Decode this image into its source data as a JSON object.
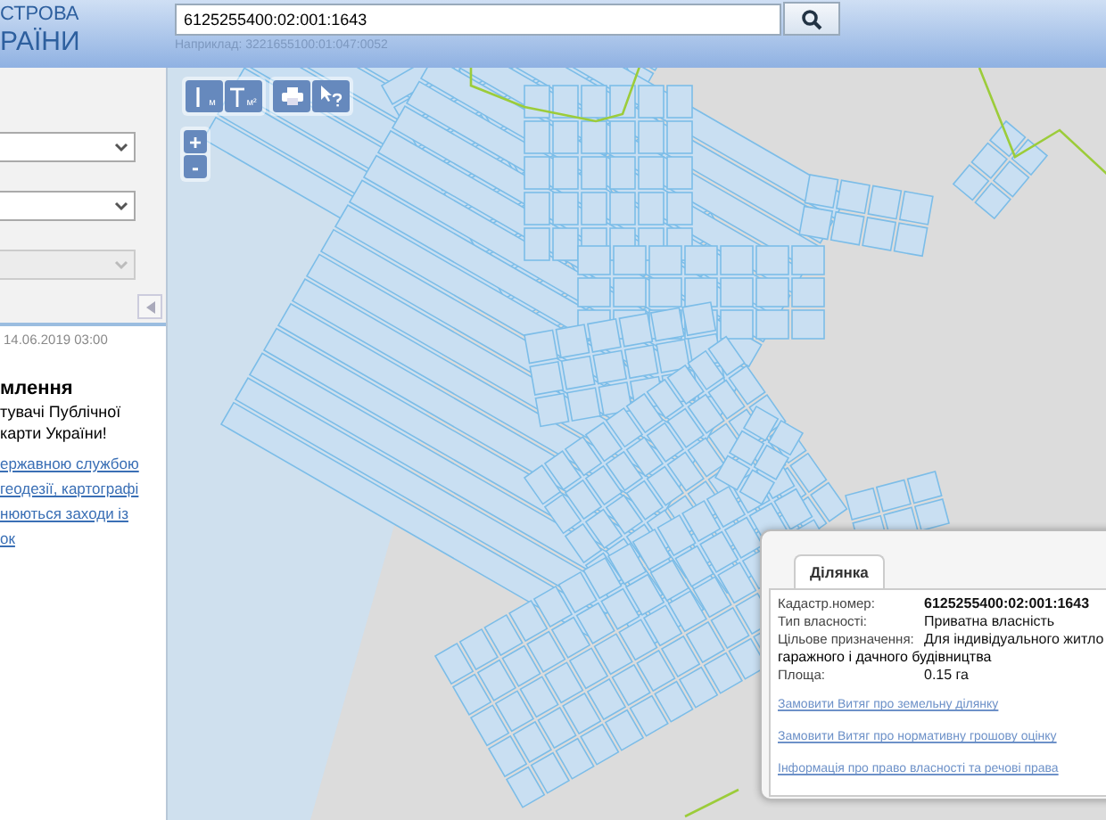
{
  "header": {
    "logo_lines": [
      "СТРОВА",
      "РАЇНИ"
    ],
    "search": {
      "value": "6125255400:02:001:1643",
      "hint": "Наприклад: 3221655100:01:047:0052"
    }
  },
  "sidebar": {
    "selects": [
      {
        "disabled": false
      },
      {
        "disabled": false
      },
      {
        "disabled": true
      }
    ],
    "date": "14.06.2019 03:00",
    "news": {
      "title": "млення",
      "lines": [
        "тувачі Публічної",
        "карти України!"
      ],
      "link_lines": [
        "ержавною службою",
        "геодезії, картографі",
        "нюються заходи із",
        "ок"
      ]
    }
  },
  "map_tools": {
    "measure_buttons": [
      {
        "unit": "м"
      },
      {
        "unit": "м²"
      }
    ],
    "zoom": [
      "+",
      "-"
    ]
  },
  "popup": {
    "tabs": [
      {
        "label": "Ділянка",
        "selected": true
      }
    ],
    "fields": [
      {
        "label": "Кадастр.номер:",
        "value": "6125255400:02:001:1643",
        "bold": true
      },
      {
        "label": "Тип власності:",
        "value": "Приватна власність",
        "bold": false
      },
      {
        "label": "Цільове призначення:",
        "value": "Для індивідуального житло",
        "bold": false,
        "continuation": "гаражного і дачного будівництва"
      },
      {
        "label": "Площа:",
        "value": "0.15 га",
        "bold": false
      }
    ],
    "links": [
      "Замовити Витяг про земельну ділянку",
      "Замовити Витяг про нормативну грошову оцінку",
      "Інформація про право власності та речові права"
    ]
  }
}
